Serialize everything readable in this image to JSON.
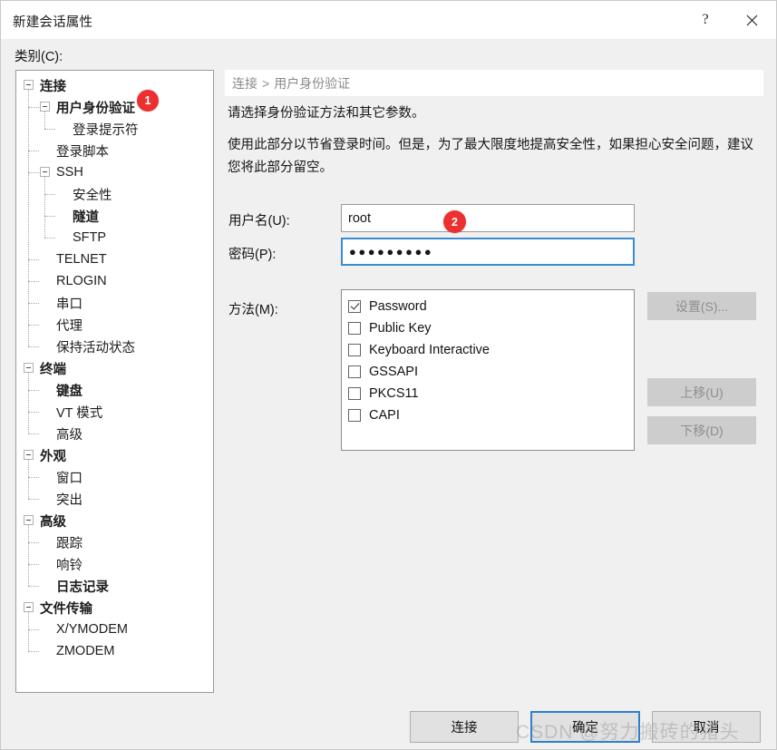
{
  "window": {
    "title": "新建会话属性",
    "help_icon": "question-mark-icon",
    "close_icon": "close-icon"
  },
  "category": {
    "label": "类别(C):"
  },
  "tree": {
    "items": [
      {
        "label": "连接",
        "level": 0,
        "bold": true,
        "expander": true
      },
      {
        "label": "用户身份验证",
        "level": 1,
        "bold": true,
        "expander": true
      },
      {
        "label": "登录提示符",
        "level": 2,
        "bold": false,
        "expander": false
      },
      {
        "label": "登录脚本",
        "level": 1,
        "bold": false,
        "expander": false
      },
      {
        "label": "SSH",
        "level": 1,
        "bold": false,
        "expander": true
      },
      {
        "label": "安全性",
        "level": 2,
        "bold": false,
        "expander": false
      },
      {
        "label": "隧道",
        "level": 2,
        "bold": true,
        "expander": false
      },
      {
        "label": "SFTP",
        "level": 2,
        "bold": false,
        "expander": false
      },
      {
        "label": "TELNET",
        "level": 1,
        "bold": false,
        "expander": false
      },
      {
        "label": "RLOGIN",
        "level": 1,
        "bold": false,
        "expander": false
      },
      {
        "label": "串口",
        "level": 1,
        "bold": false,
        "expander": false
      },
      {
        "label": "代理",
        "level": 1,
        "bold": false,
        "expander": false
      },
      {
        "label": "保持活动状态",
        "level": 1,
        "bold": false,
        "expander": false
      },
      {
        "label": "终端",
        "level": 0,
        "bold": true,
        "expander": true
      },
      {
        "label": "键盘",
        "level": 1,
        "bold": true,
        "expander": false
      },
      {
        "label": "VT 模式",
        "level": 1,
        "bold": false,
        "expander": false
      },
      {
        "label": "高级",
        "level": 1,
        "bold": false,
        "expander": false
      },
      {
        "label": "外观",
        "level": 0,
        "bold": true,
        "expander": true
      },
      {
        "label": "窗口",
        "level": 1,
        "bold": false,
        "expander": false
      },
      {
        "label": "突出",
        "level": 1,
        "bold": false,
        "expander": false
      },
      {
        "label": "高级",
        "level": 0,
        "bold": true,
        "expander": true
      },
      {
        "label": "跟踪",
        "level": 1,
        "bold": false,
        "expander": false
      },
      {
        "label": "响铃",
        "level": 1,
        "bold": false,
        "expander": false
      },
      {
        "label": "日志记录",
        "level": 1,
        "bold": true,
        "expander": false
      },
      {
        "label": "文件传输",
        "level": 0,
        "bold": true,
        "expander": true
      },
      {
        "label": "X/YMODEM",
        "level": 1,
        "bold": false,
        "expander": false
      },
      {
        "label": "ZMODEM",
        "level": 1,
        "bold": false,
        "expander": false
      }
    ]
  },
  "breadcrumb": {
    "root": "连接",
    "separator": ">",
    "current": "用户身份验证"
  },
  "content": {
    "paragraph1": "请选择身份验证方法和其它参数。",
    "paragraph2": "使用此部分以节省登录时间。但是，为了最大限度地提高安全性，如果担心安全问题，建议您将此部分留空。"
  },
  "form": {
    "username_label": "用户名(U):",
    "username_value": "root",
    "password_label": "密码(P):",
    "password_value": "●●●●●●●●●",
    "method_label": "方法(M):",
    "methods": [
      {
        "label": "Password",
        "checked": true
      },
      {
        "label": "Public Key",
        "checked": false
      },
      {
        "label": "Keyboard Interactive",
        "checked": false
      },
      {
        "label": "GSSAPI",
        "checked": false
      },
      {
        "label": "PKCS11",
        "checked": false
      },
      {
        "label": "CAPI",
        "checked": false
      }
    ]
  },
  "side_buttons": {
    "settings": "设置(S)...",
    "move_up": "上移(U)",
    "move_down": "下移(D)"
  },
  "bottom_buttons": {
    "connect": "连接",
    "ok": "确定",
    "cancel": "取消"
  },
  "annotations": {
    "badge1": "1",
    "badge2": "2"
  },
  "watermark": {
    "text": "CSDN @努力搬砖的猪头"
  },
  "colors": {
    "accent_blue": "#2f7fd0",
    "badge_red": "#ec2f2f",
    "dialog_bg": "#f0f0f0",
    "panel_white": "#ffffff",
    "disabled_btn": "#cdcdcd"
  }
}
